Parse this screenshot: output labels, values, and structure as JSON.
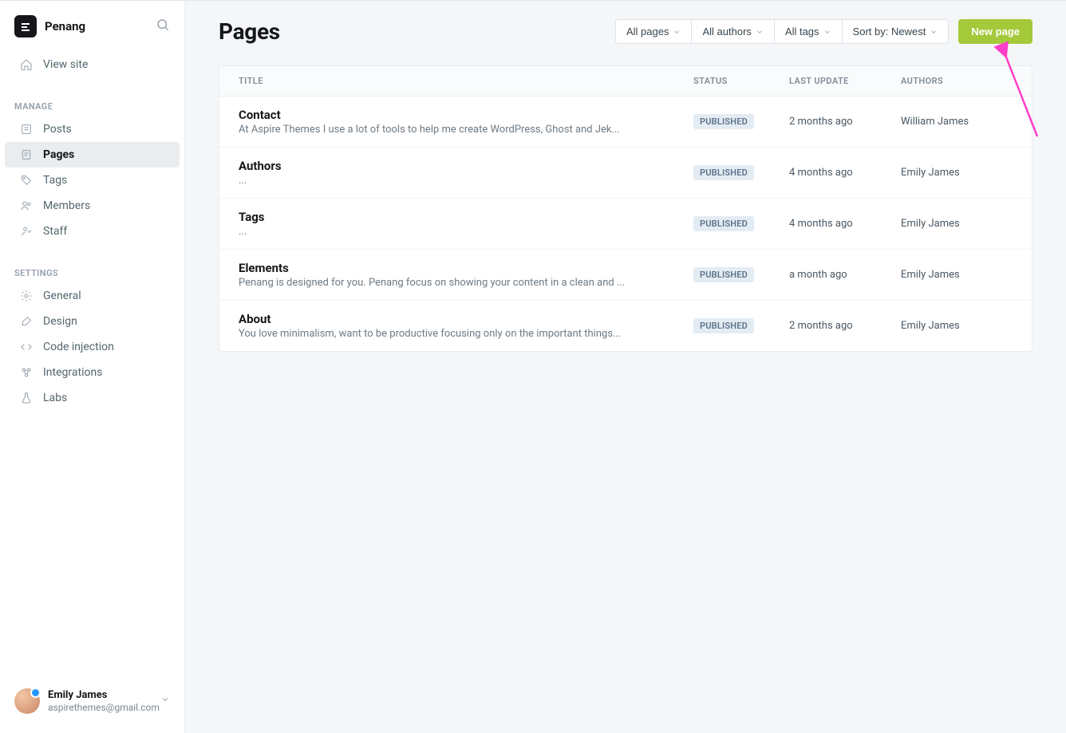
{
  "site_name": "Penang",
  "sidebar": {
    "view_site": "View site",
    "manage_label": "MANAGE",
    "settings_label": "SETTINGS",
    "manage_items": [
      {
        "label": "Posts",
        "icon": "posts"
      },
      {
        "label": "Pages",
        "icon": "pages",
        "active": true
      },
      {
        "label": "Tags",
        "icon": "tags"
      },
      {
        "label": "Members",
        "icon": "members"
      },
      {
        "label": "Staff",
        "icon": "staff"
      }
    ],
    "settings_items": [
      {
        "label": "General",
        "icon": "gear"
      },
      {
        "label": "Design",
        "icon": "brush"
      },
      {
        "label": "Code injection",
        "icon": "code"
      },
      {
        "label": "Integrations",
        "icon": "integrations"
      },
      {
        "label": "Labs",
        "icon": "labs"
      }
    ]
  },
  "user": {
    "name": "Emily James",
    "email": "aspirethemes@gmail.com"
  },
  "page_title": "Pages",
  "filters": {
    "pages": "All pages",
    "authors": "All authors",
    "tags": "All tags",
    "sort": "Sort by: Newest"
  },
  "new_button": "New page",
  "columns": {
    "title": "TITLE",
    "status": "STATUS",
    "update": "LAST UPDATE",
    "authors": "AUTHORS"
  },
  "rows": [
    {
      "title": "Contact",
      "excerpt": "At Aspire Themes I use a lot of tools to help me create WordPress, Ghost and Jek...",
      "status": "PUBLISHED",
      "update": "2 months ago",
      "author": "William James"
    },
    {
      "title": "Authors",
      "excerpt": "...",
      "status": "PUBLISHED",
      "update": "4 months ago",
      "author": "Emily James"
    },
    {
      "title": "Tags",
      "excerpt": "...",
      "status": "PUBLISHED",
      "update": "4 months ago",
      "author": "Emily James"
    },
    {
      "title": "Elements",
      "excerpt": "Penang is designed for you. Penang focus on showing your content in a clean and ...",
      "status": "PUBLISHED",
      "update": "a month ago",
      "author": "Emily James"
    },
    {
      "title": "About",
      "excerpt": "You love minimalism, want to be productive focusing only on the important things...",
      "status": "PUBLISHED",
      "update": "2 months ago",
      "author": "Emily James"
    }
  ]
}
